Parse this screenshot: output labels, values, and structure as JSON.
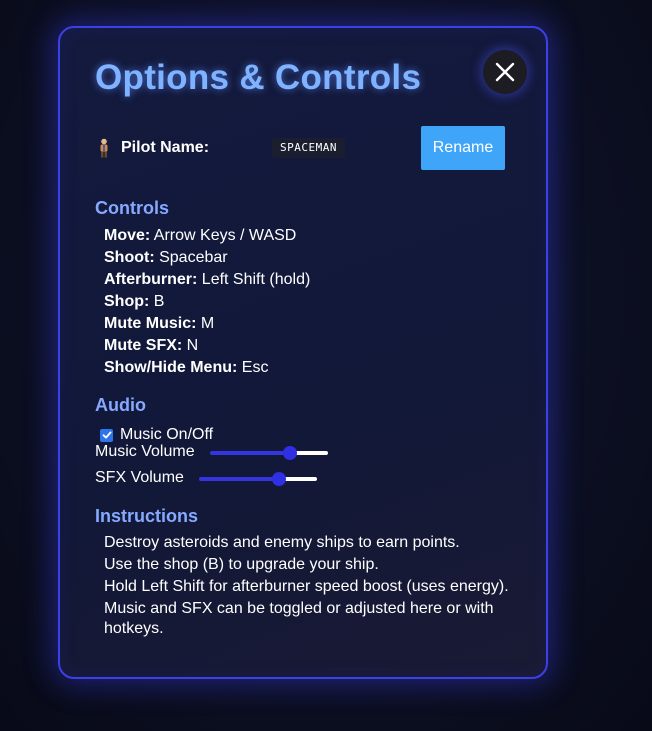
{
  "modal": {
    "title": "Options & Controls",
    "close_icon": "close-x-icon"
  },
  "pilot": {
    "icon": "pilot-figure-icon",
    "label": "Pilot Name:",
    "name": "SPACEMAN",
    "rename_label": "Rename"
  },
  "controls": {
    "heading": "Controls",
    "items": [
      {
        "key": "Move:",
        "value": "Arrow Keys / WASD"
      },
      {
        "key": "Shoot:",
        "value": "Spacebar"
      },
      {
        "key": "Afterburner:",
        "value": "Left Shift (hold)"
      },
      {
        "key": "Shop:",
        "value": "B"
      },
      {
        "key": "Mute Music:",
        "value": "M"
      },
      {
        "key": "Mute SFX:",
        "value": "N"
      },
      {
        "key": "Show/Hide Menu:",
        "value": "Esc"
      }
    ]
  },
  "audio": {
    "heading": "Audio",
    "music_toggle_label": "Music On/Off",
    "music_toggle_checked": true,
    "music_volume_label": "Music Volume",
    "music_volume": 0.68,
    "sfx_volume_label": "SFX Volume",
    "sfx_volume": 0.68
  },
  "instructions": {
    "heading": "Instructions",
    "lines": [
      "Destroy asteroids and enemy ships to earn points.",
      "Use the shop (B) to upgrade your ship.",
      "Hold Left Shift for afterburner speed boost (uses energy).",
      "Music and SFX can be toggled or adjusted here or with hotkeys."
    ]
  },
  "colors": {
    "accent_title": "#7fb2ff",
    "section_heading": "#86a8ff",
    "modal_border": "#3d40e6",
    "button": "#3fa5f8",
    "slider_fill": "#3434e0"
  }
}
